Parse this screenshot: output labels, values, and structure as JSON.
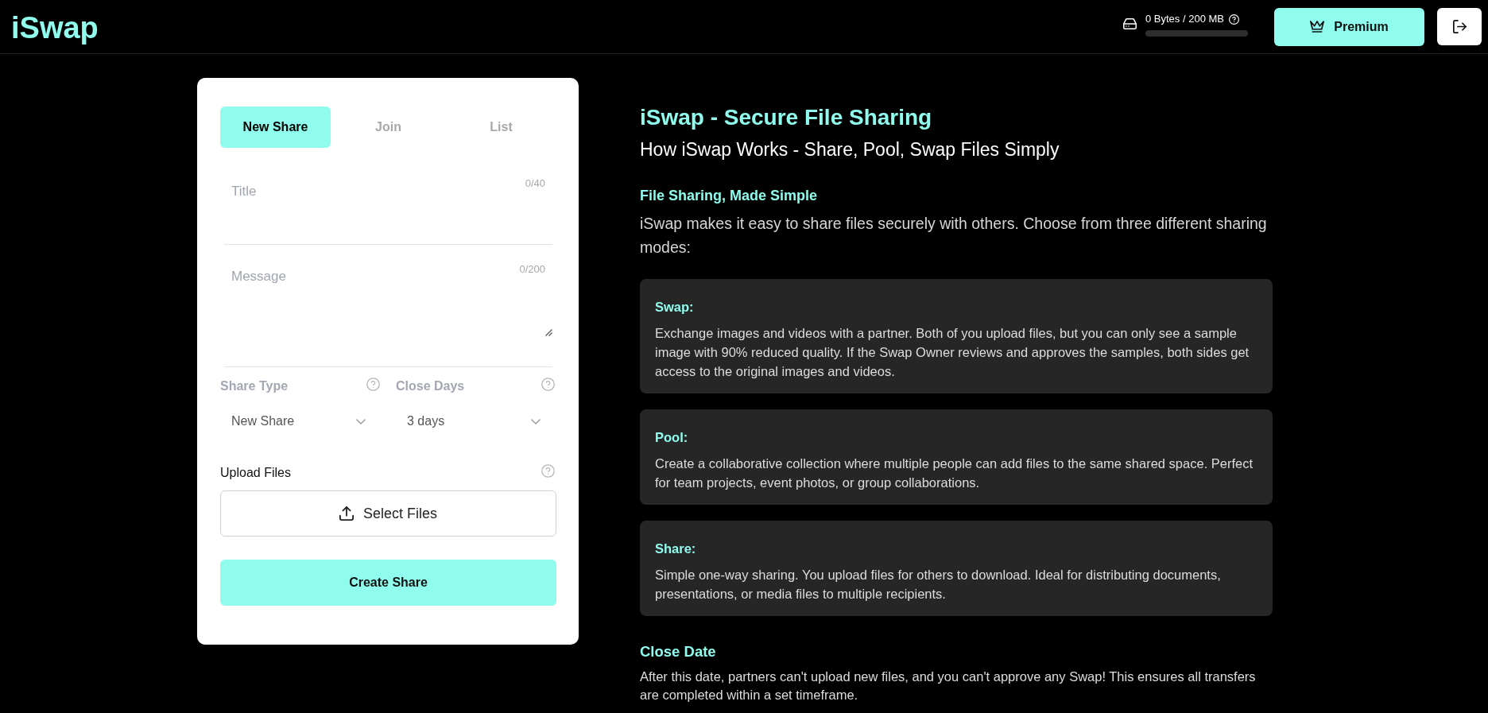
{
  "header": {
    "logo": "iSwap",
    "storage": {
      "text": "0 Bytes / 200 MB",
      "level": 0
    },
    "premium_button": "Premium"
  },
  "form": {
    "tabs": [
      {
        "label": "New Share",
        "selected": true
      },
      {
        "label": "Join",
        "selected": false
      },
      {
        "label": "List",
        "selected": false
      }
    ],
    "fields": [
      {
        "kind": "input",
        "placeholder": "Title",
        "counter": "0/40"
      },
      {
        "kind": "textarea",
        "placeholder": "Message",
        "counter": "0/200"
      }
    ],
    "selects": [
      {
        "label": "Share Type",
        "value": "New Share"
      },
      {
        "label": "Close Days",
        "value": "3 days"
      }
    ],
    "upload": {
      "label": "Upload Files",
      "button": "Select Files"
    },
    "submit_button": "Create Share"
  },
  "info": {
    "title": "iSwap - Secure File Sharing",
    "subtitle": "How iSwap Works - Share, Pool, Swap Files Simply",
    "intro": {
      "heading": "File Sharing, Made Simple",
      "text": "iSwap makes it easy to share files securely with others. Choose from three different sharing modes:"
    },
    "modes": [
      {
        "name": "Swap:",
        "description": "Exchange images and videos with a partner. Both of you upload files, but you can only see a sample image with 90% reduced quality. If the Swap Owner reviews and approves the samples, both sides get access to the original images and videos."
      },
      {
        "name": "Pool:",
        "description": "Create a collaborative collection where multiple people can add files to the same shared space. Perfect for team projects, event photos, or group collaborations."
      },
      {
        "name": "Share:",
        "description": "Simple one-way sharing. You upload files for others to download. Ideal for distributing documents, presentations, or media files to multiple recipients."
      }
    ],
    "close_date": {
      "heading": "Close Date",
      "text": "After this date, partners can't upload new files, and you can't approve any Swap! This ensures all transfers are completed within a set timeframe."
    }
  }
}
